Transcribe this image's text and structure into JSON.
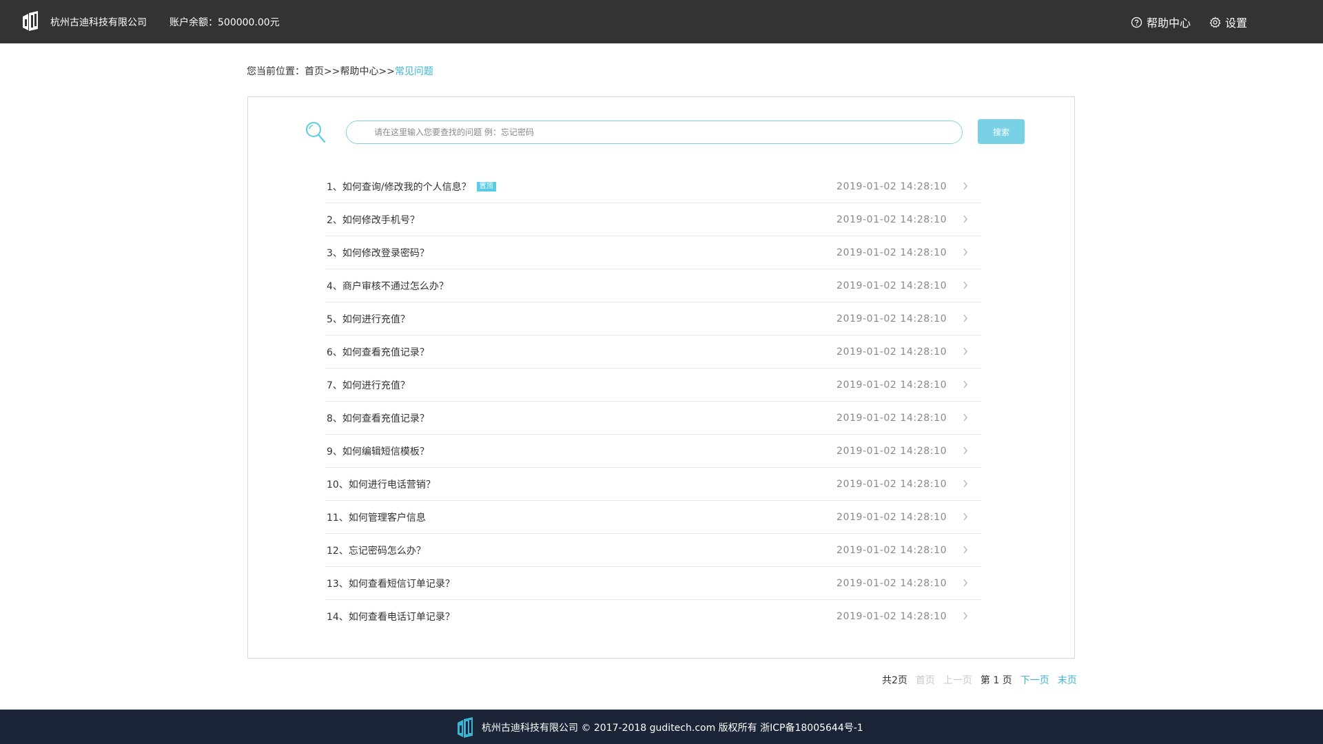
{
  "header": {
    "company": "杭州古迪科技有限公司",
    "balance": "账户余额：500000.00元",
    "help_label": "帮助中心",
    "settings_label": "设置"
  },
  "breadcrumb": {
    "prefix": "您当前位置：",
    "home": "首页",
    "sep1": ">>",
    "help": "帮助中心",
    "sep2": ">>",
    "current": "常见问题"
  },
  "search": {
    "placeholder": "请在这里输入您要查找的问题 例：忘记密码",
    "button_label": "搜索"
  },
  "faq": {
    "pin_label": "置顶",
    "items": [
      {
        "title": "1、如何查询/修改我的个人信息？",
        "date": "2019-01-02 14:28:10",
        "pinned": true
      },
      {
        "title": "2、如何修改手机号？",
        "date": "2019-01-02 14:28:10",
        "pinned": false
      },
      {
        "title": "3、如何修改登录密码？",
        "date": "2019-01-02 14:28:10",
        "pinned": false
      },
      {
        "title": "4、商户审核不通过怎么办？",
        "date": "2019-01-02 14:28:10",
        "pinned": false
      },
      {
        "title": "5、如何进行充值？",
        "date": "2019-01-02 14:28:10",
        "pinned": false
      },
      {
        "title": "6、如何查看充值记录？",
        "date": "2019-01-02 14:28:10",
        "pinned": false
      },
      {
        "title": "7、如何进行充值？",
        "date": "2019-01-02 14:28:10",
        "pinned": false
      },
      {
        "title": "8、如何查看充值记录？",
        "date": "2019-01-02 14:28:10",
        "pinned": false
      },
      {
        "title": "9、如何编辑短信模板？",
        "date": "2019-01-02 14:28:10",
        "pinned": false
      },
      {
        "title": "10、如何进行电话营销？",
        "date": "2019-01-02 14:28:10",
        "pinned": false
      },
      {
        "title": "11、如何管理客户信息",
        "date": "2019-01-02 14:28:10",
        "pinned": false
      },
      {
        "title": "12、忘记密码怎么办？",
        "date": "2019-01-02 14:28:10",
        "pinned": false
      },
      {
        "title": "13、如何查看短信订单记录？",
        "date": "2019-01-02 14:28:10",
        "pinned": false
      },
      {
        "title": "14、如何查看电话订单记录？",
        "date": "2019-01-02 14:28:10",
        "pinned": false
      }
    ]
  },
  "pagination": {
    "total": "共2页",
    "first": "首页",
    "prev": "上一页",
    "current": "第 1 页",
    "next": "下一页",
    "last": "末页"
  },
  "footer": {
    "text": "杭州古迪科技有限公司 © 2017-2018 guditech.com 版权所有 浙ICP备18005644号-1"
  },
  "colors": {
    "header_bg": "#333333",
    "accent": "#3ab6d4",
    "footer_bg": "#1c2538"
  }
}
